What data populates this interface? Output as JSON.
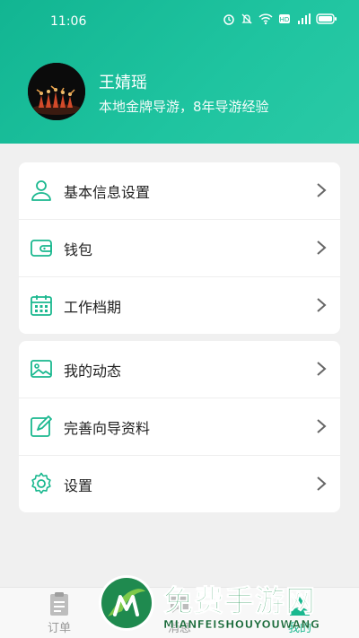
{
  "status_bar": {
    "time": "11:06"
  },
  "profile": {
    "name": "王婧瑶",
    "description": "本地金牌导游，8年导游经验"
  },
  "menu_group_1": [
    {
      "label": "基本信息设置",
      "icon": "person-icon"
    },
    {
      "label": "钱包",
      "icon": "wallet-icon"
    },
    {
      "label": "工作档期",
      "icon": "calendar-icon"
    }
  ],
  "menu_group_2": [
    {
      "label": "我的动态",
      "icon": "image-icon"
    },
    {
      "label": "完善向导资料",
      "icon": "edit-icon"
    },
    {
      "label": "设置",
      "icon": "gear-icon"
    }
  ],
  "tabbar": [
    {
      "label": "订单",
      "icon": "clipboard-icon",
      "active": false
    },
    {
      "label": "消息",
      "icon": "message-icon",
      "active": false
    },
    {
      "label": "我的",
      "icon": "person-icon",
      "active": true
    }
  ],
  "watermark": {
    "title": "免费手游网",
    "subtitle": "MIANFEISHOUYOUWANG"
  },
  "colors": {
    "accent": "#1ab88f",
    "header": "#16bb96"
  }
}
